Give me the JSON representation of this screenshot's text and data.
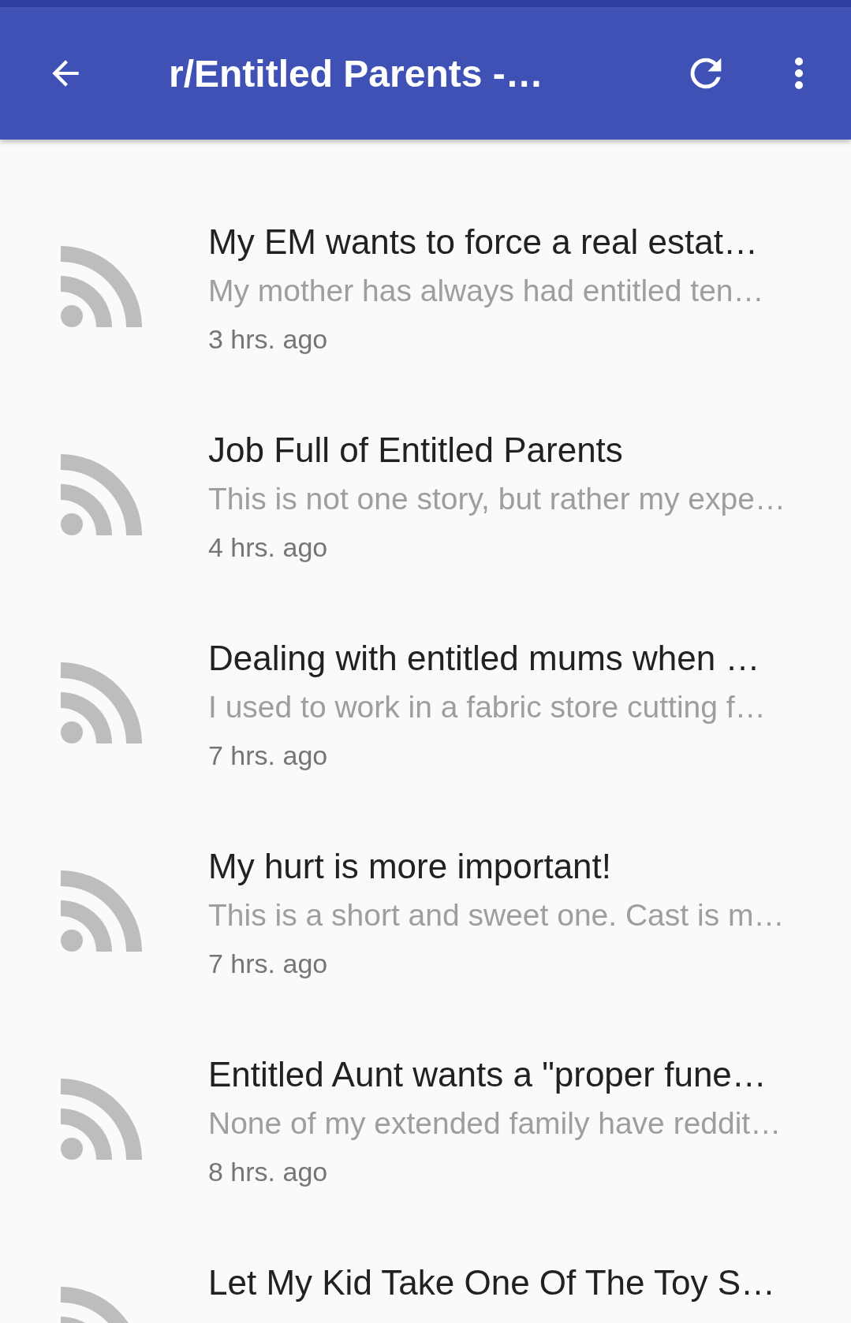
{
  "app_bar": {
    "title": "r/Entitled Parents -…"
  },
  "posts": [
    {
      "title": "My EM wants to force a real estat…",
      "snippet": "My mother has always had entitled ten…",
      "time": "3 hrs. ago"
    },
    {
      "title": "Job Full of Entitled Parents",
      "snippet": "This is not one story, but rather my expe…",
      "time": "4 hrs. ago"
    },
    {
      "title": "Dealing with entitled mums when …",
      "snippet": "I used to work in a fabric store cutting f…",
      "time": "7 hrs. ago"
    },
    {
      "title": "My hurt is more important!",
      "snippet": "This is a short and sweet one. Cast is m…",
      "time": "7 hrs. ago"
    },
    {
      "title": "Entitled Aunt wants a \"proper fune…",
      "snippet": "None of my extended family have reddit…",
      "time": "8 hrs. ago"
    },
    {
      "title": "Let My Kid Take One Of The Toy S…"
    }
  ]
}
